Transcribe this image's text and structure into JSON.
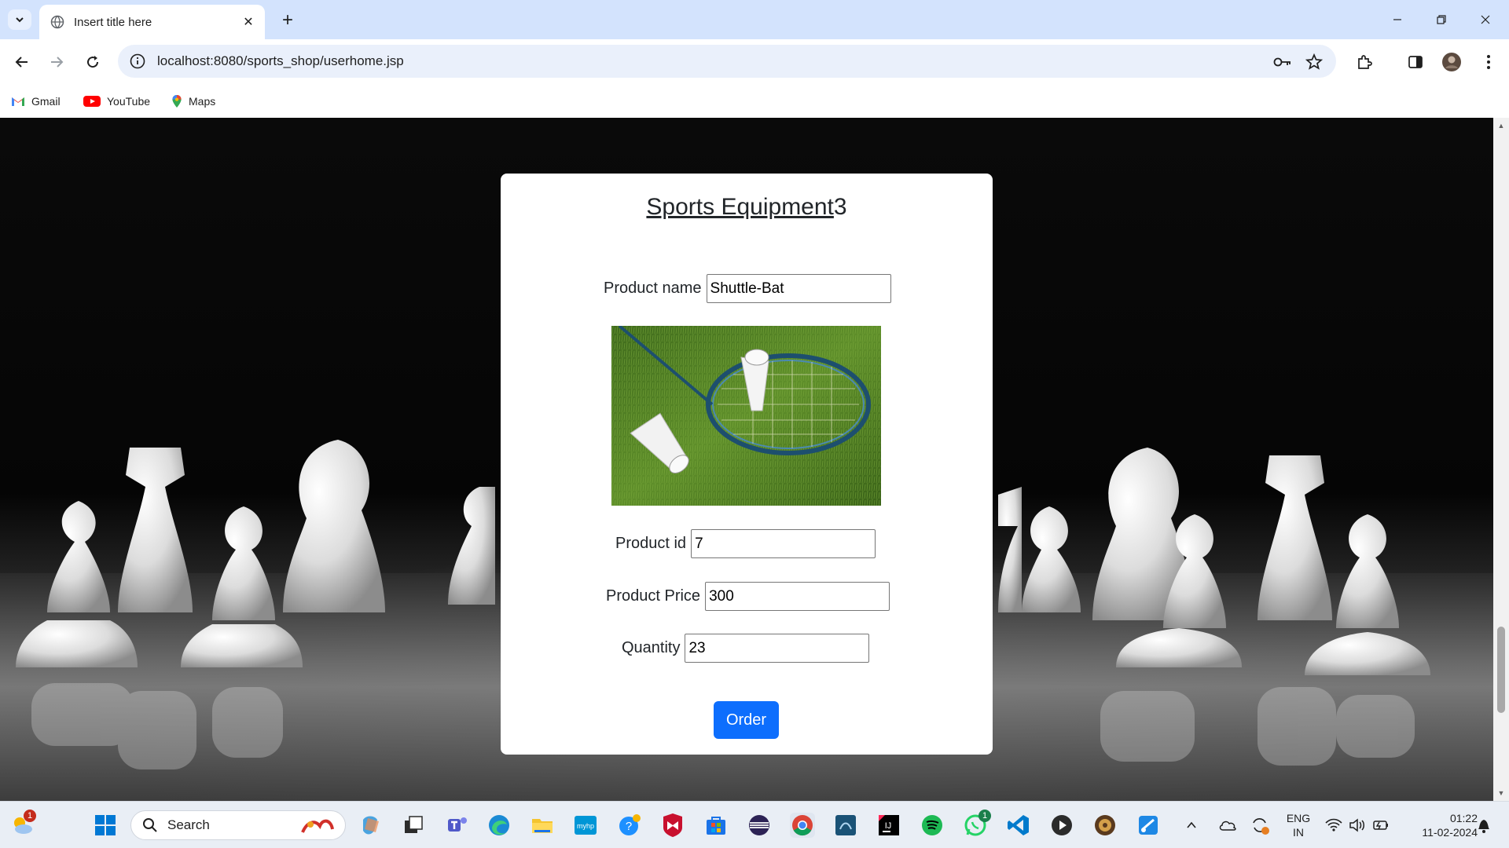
{
  "browser": {
    "tab_title": "Insert title here",
    "url": "localhost:8080/sports_shop/userhome.jsp",
    "bookmarks": [
      {
        "label": "Gmail",
        "icon": "gmail-icon"
      },
      {
        "label": "YouTube",
        "icon": "youtube-icon"
      },
      {
        "label": "Maps",
        "icon": "maps-icon"
      }
    ]
  },
  "card": {
    "title_underlined": "Sports Equipment",
    "title_suffix": "3",
    "fields": {
      "product_name": {
        "label": "Product name",
        "value": "Shuttle-Bat"
      },
      "product_id": {
        "label": "Product id",
        "value": "7"
      },
      "product_price": {
        "label": "Product Price",
        "value": "300"
      },
      "quantity": {
        "label": "Quantity",
        "value": "23"
      }
    },
    "order_label": "Order"
  },
  "taskbar": {
    "search_label": "Search",
    "lang_top": "ENG",
    "lang_bottom": "IN",
    "time": "01:22",
    "date": "11-02-2024",
    "weather_badge": "1",
    "whatsapp_badge": "1"
  },
  "colors": {
    "tabstrip": "#d3e3fd",
    "order_button": "#0d6efd",
    "taskbar": "#e9eef5"
  }
}
